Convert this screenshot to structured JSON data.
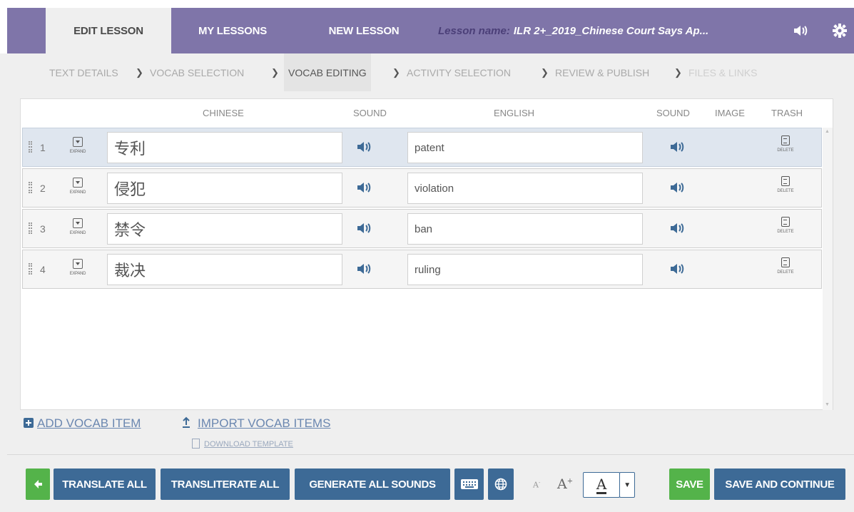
{
  "topbar": {
    "tabs": [
      {
        "label": "Edit Lesson",
        "active": true
      },
      {
        "label": "My Lessons",
        "active": false
      },
      {
        "label": "New Lesson",
        "active": false
      }
    ],
    "lesson_name_label": "Lesson name:",
    "lesson_name": "ILR 2+_2019_Chinese Court Says Ap...",
    "icons": [
      "speaker-icon",
      "gear-icon"
    ]
  },
  "breadcrumb": [
    {
      "label": "Text Details",
      "state": "done"
    },
    {
      "label": "Vocab Selection",
      "state": "done"
    },
    {
      "label": "Vocab Editing",
      "state": "current"
    },
    {
      "label": "Activity Selection",
      "state": "todo"
    },
    {
      "label": "Review & Publish",
      "state": "todo"
    },
    {
      "label": "Files & Links",
      "state": "disabled"
    }
  ],
  "table": {
    "headers": {
      "chinese": "Chinese",
      "sound1": "Sound",
      "english": "English",
      "sound2": "Sound",
      "image": "Image",
      "trash": "Trash"
    },
    "expand_label": "Expand",
    "delete_label": "Delete",
    "rows": [
      {
        "num": "1",
        "chinese": "专利",
        "english": "patent",
        "selected": true
      },
      {
        "num": "2",
        "chinese": "侵犯",
        "english": "violation",
        "selected": false
      },
      {
        "num": "3",
        "chinese": "禁令",
        "english": "ban",
        "selected": false
      },
      {
        "num": "4",
        "chinese": "裁决",
        "english": "ruling",
        "selected": false
      }
    ]
  },
  "links": {
    "add_vocab": "Add Vocab Item",
    "import_vocab": "Import Vocab Items",
    "download_template": "Download Template"
  },
  "toolbar": {
    "translate_all": "Translate All",
    "transliterate_all": "Transliterate All",
    "generate_all_sounds": "Generate All Sounds",
    "font_color_letter": "A",
    "save": "Save",
    "save_and_continue": "Save and Continue"
  },
  "colors": {
    "header_purple": "#7f75a9",
    "button_blue": "#3d6a96",
    "button_green": "#54b34a",
    "link_blue": "#6b87b0"
  }
}
